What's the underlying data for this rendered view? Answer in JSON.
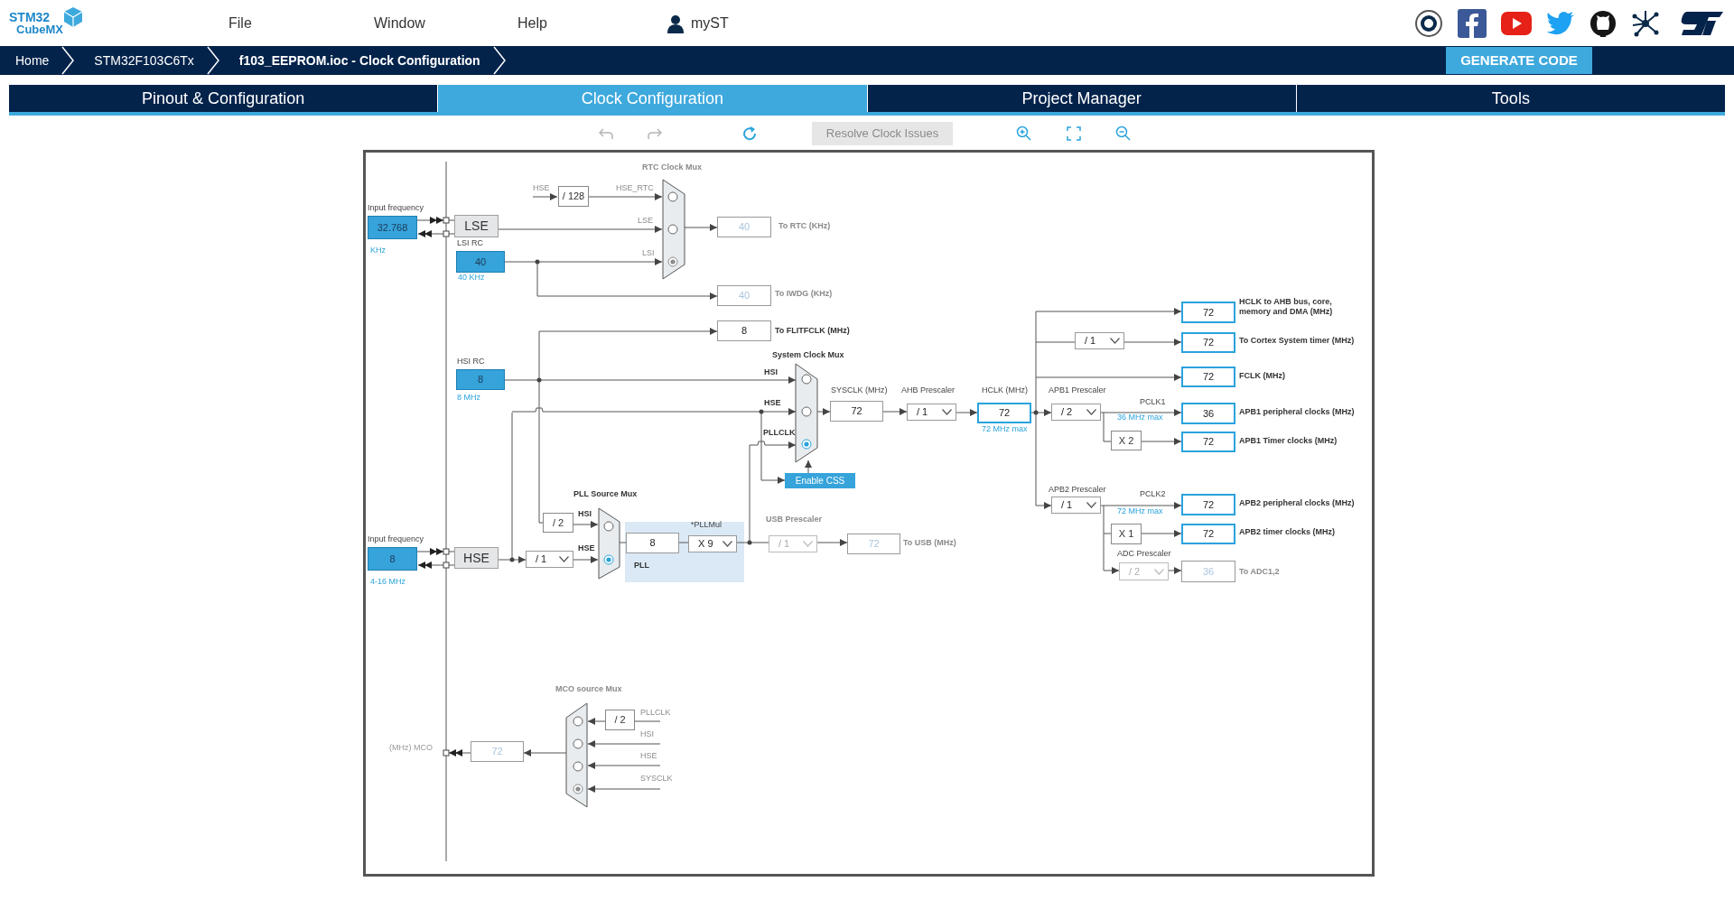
{
  "header": {
    "logo": [
      "STM32",
      "CubeMX"
    ],
    "menu": [
      "File",
      "Window",
      "Help"
    ],
    "account": "myST"
  },
  "breadcrumbs": [
    "Home",
    "STM32F103C6Tx",
    "f103_EEPROM.ioc - Clock Configuration"
  ],
  "generate_button": "GENERATE CODE",
  "tabs": [
    {
      "label": "Pinout & Configuration",
      "selected": false
    },
    {
      "label": "Clock Configuration",
      "selected": true
    },
    {
      "label": "Project Manager",
      "selected": false
    },
    {
      "label": "Tools",
      "selected": false
    }
  ],
  "toolbar": {
    "undo": {
      "disabled": true
    },
    "redo": {
      "disabled": true
    },
    "resolve": {
      "label": "Resolve Clock Issues",
      "disabled": true
    }
  },
  "diagram": {
    "labels": [
      {
        "text": "RTC Clock Mux",
        "kind": "heading",
        "disabled": true
      },
      {
        "text": "HSE",
        "kind": "signal",
        "disabled": true
      },
      {
        "text": "HSE_RTC",
        "kind": "signal",
        "disabled": true
      },
      {
        "text": "Input frequency",
        "kind": "caption",
        "disabled": false
      },
      {
        "text": "LSE",
        "kind": "signal",
        "disabled": true
      },
      {
        "text": "To RTC (KHz)",
        "kind": "heading",
        "disabled": true
      },
      {
        "text": "LSI RC",
        "kind": "caption",
        "disabled": false
      },
      {
        "text": "KHz",
        "kind": "hint",
        "disabled": false
      },
      {
        "text": "LSI",
        "kind": "signal",
        "disabled": true
      },
      {
        "text": "40 KHz",
        "kind": "hint",
        "disabled": false
      },
      {
        "text": "To IWDG (KHz)",
        "kind": "heading",
        "disabled": true
      },
      {
        "text": "To FLITFCLK (MHz)",
        "kind": "heading",
        "disabled": false
      },
      {
        "text": "System Clock Mux",
        "kind": "heading",
        "disabled": false
      },
      {
        "text": "HSI RC",
        "kind": "caption",
        "disabled": false
      },
      {
        "text": "HSI",
        "kind": "signal",
        "disabled": false
      },
      {
        "text": "SYSCLK (MHz)",
        "kind": "caption",
        "disabled": false
      },
      {
        "text": "AHB Prescaler",
        "kind": "caption",
        "disabled": false
      },
      {
        "text": "HCLK (MHz)",
        "kind": "caption",
        "disabled": false
      },
      {
        "text": "APB1 Prescaler",
        "kind": "caption",
        "disabled": false
      },
      {
        "text": "8 MHz",
        "kind": "hint",
        "disabled": false
      },
      {
        "text": "PCLK1",
        "kind": "caption",
        "disabled": false
      },
      {
        "text": "HSE",
        "kind": "signal",
        "disabled": false
      },
      {
        "text": "36 MHz max",
        "kind": "hint",
        "disabled": false
      },
      {
        "text": "72 MHz max",
        "kind": "hint",
        "disabled": false
      },
      {
        "text": "PLLCLK",
        "kind": "signal",
        "disabled": false
      },
      {
        "text": "HCLK to AHB bus, core, memory and DMA (MHz)",
        "kind": "heading",
        "disabled": false
      },
      {
        "text": "To Cortex System timer (MHz)",
        "kind": "heading",
        "disabled": false
      },
      {
        "text": "FCLK (MHz)",
        "kind": "heading",
        "disabled": false
      },
      {
        "text": "APB1 peripheral clocks (MHz)",
        "kind": "heading",
        "disabled": false
      },
      {
        "text": "APB1 Timer clocks (MHz)",
        "kind": "heading",
        "disabled": false
      },
      {
        "text": "APB2 Prescaler",
        "kind": "caption",
        "disabled": false
      },
      {
        "text": "PLL Source Mux",
        "kind": "heading",
        "disabled": false
      },
      {
        "text": "PCLK2",
        "kind": "caption",
        "disabled": false
      },
      {
        "text": "APB2 peripheral clocks (MHz)",
        "kind": "heading",
        "disabled": false
      },
      {
        "text": "72 MHz max",
        "kind": "hint",
        "disabled": false
      },
      {
        "text": "HSI",
        "kind": "signal",
        "disabled": false
      },
      {
        "text": "USB Prescaler",
        "kind": "heading",
        "disabled": true
      },
      {
        "text": "*PLLMul",
        "kind": "caption",
        "disabled": false
      },
      {
        "text": "APB2 timer clocks (MHz)",
        "kind": "heading",
        "disabled": false
      },
      {
        "text": "Input frequency",
        "kind": "caption",
        "disabled": false
      },
      {
        "text": "To USB (MHz)",
        "kind": "heading",
        "disabled": true
      },
      {
        "text": "HSE",
        "kind": "signal",
        "disabled": false
      },
      {
        "text": "ADC Prescaler",
        "kind": "caption",
        "disabled": false
      },
      {
        "text": "PLL",
        "kind": "heading",
        "disabled": false
      },
      {
        "text": "To ADC1,2",
        "kind": "heading",
        "disabled": true
      },
      {
        "text": "4-16 MHz",
        "kind": "hint",
        "disabled": false
      },
      {
        "text": "MCO source Mux",
        "kind": "heading",
        "disabled": true
      },
      {
        "text": "PLLCLK",
        "kind": "signal",
        "disabled": true
      },
      {
        "text": "HSI",
        "kind": "signal",
        "disabled": true
      },
      {
        "text": "(MHz) MCO",
        "kind": "caption",
        "disabled": true
      },
      {
        "text": "HSE",
        "kind": "signal",
        "disabled": true
      },
      {
        "text": "SYSCLK",
        "kind": "signal",
        "disabled": true
      }
    ],
    "inputs": [
      "32.768",
      "40",
      "8",
      "8"
    ],
    "sources": [
      "LSE",
      "HSE"
    ],
    "fixed_dividers": [
      "/ 128",
      "/ 2",
      "X 2",
      "X 1",
      "/ 2"
    ],
    "outputs": [
      {
        "value": "40",
        "highlighted": false,
        "disabled": true
      },
      {
        "value": "40",
        "highlighted": false,
        "disabled": true
      },
      {
        "value": "8",
        "highlighted": false,
        "disabled": false
      },
      {
        "value": "72",
        "highlighted": true,
        "disabled": false
      },
      {
        "value": "72",
        "highlighted": true,
        "disabled": false
      },
      {
        "value": "72",
        "highlighted": true,
        "disabled": false
      },
      {
        "value": "72",
        "highlighted": false,
        "disabled": false
      },
      {
        "value": "72",
        "highlighted": true,
        "disabled": false
      },
      {
        "value": "36",
        "highlighted": true,
        "disabled": false
      },
      {
        "value": "72",
        "highlighted": true,
        "disabled": false
      },
      {
        "value": "72",
        "highlighted": true,
        "disabled": false
      },
      {
        "value": "72",
        "highlighted": true,
        "disabled": false
      },
      {
        "value": "8",
        "highlighted": false,
        "disabled": false
      },
      {
        "value": "72",
        "highlighted": false,
        "disabled": true
      },
      {
        "value": "36",
        "highlighted": false,
        "disabled": true
      },
      {
        "value": "72",
        "highlighted": false,
        "disabled": true
      }
    ],
    "dropdowns": [
      {
        "value": "/ 1",
        "disabled": false
      },
      {
        "value": "/ 1",
        "disabled": false
      },
      {
        "value": "/ 2",
        "disabled": false
      },
      {
        "value": "/ 1",
        "disabled": false
      },
      {
        "value": "X 9",
        "disabled": false
      },
      {
        "value": "/ 1",
        "disabled": true
      },
      {
        "value": "/ 1",
        "disabled": false
      },
      {
        "value": "/ 2",
        "disabled": true
      }
    ],
    "buttons": [
      "Enable CSS"
    ],
    "muxes": [
      {
        "active": false,
        "options": [
          {
            "selected": false
          },
          {
            "selected": false
          },
          {
            "selected": true
          }
        ]
      },
      {
        "active": true,
        "options": [
          {
            "selected": false
          },
          {
            "selected": false
          },
          {
            "selected": true
          }
        ]
      },
      {
        "active": true,
        "options": [
          {
            "selected": false
          },
          {
            "selected": true
          }
        ]
      },
      {
        "active": false,
        "options": [
          {
            "selected": false
          },
          {
            "selected": false
          },
          {
            "selected": false
          },
          {
            "selected": true
          }
        ]
      }
    ]
  }
}
